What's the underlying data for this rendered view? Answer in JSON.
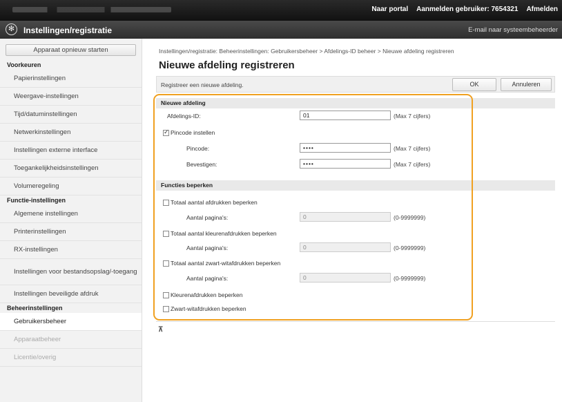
{
  "topbar": {
    "portal": "Naar portal",
    "logged_in_label": "Aanmelden gebruiker:",
    "user_id": "7654321",
    "logout": "Afmelden"
  },
  "titlebar": {
    "title": "Instellingen/registratie",
    "mail_admin": "E-mail naar systeembeheerder"
  },
  "sidebar": {
    "restart_button": "Apparaat opnieuw starten",
    "groups": [
      {
        "label": "Voorkeuren",
        "items": [
          "Papierinstellingen",
          "Weergave-instellingen",
          "Tijd/datuminstellingen",
          "Netwerkinstellingen",
          "Instellingen externe interface",
          "Toegankelijkheidsinstellingen",
          "Volumeregeling"
        ]
      },
      {
        "label": "Functie-instellingen",
        "items": [
          "Algemene instellingen",
          "Printerinstellingen",
          "RX-instellingen",
          "Instellingen voor bestandsopslag/-toegang",
          "Instellingen beveiligde afdruk"
        ]
      },
      {
        "label": "Beheerinstellingen",
        "items": [
          "Gebruikersbeheer",
          "Apparaatbeheer",
          "Licentie/overig"
        ]
      }
    ]
  },
  "breadcrumb": "Instellingen/registratie: Beheerinstellingen: Gebruikersbeheer > Afdelings-ID beheer > Nieuwe afdeling registreren",
  "page_title": "Nieuwe afdeling registreren",
  "actionbar": {
    "description": "Registreer een nieuwe afdeling.",
    "ok": "OK",
    "cancel": "Annuleren"
  },
  "new_department": {
    "heading": "Nieuwe afdeling",
    "dept_id_label": "Afdelings-ID:",
    "dept_id_value": "01",
    "dept_id_hint": "(Max 7 cijfers)",
    "set_pin_label": "Pincode instellen",
    "set_pin_checked": true,
    "pin_label": "Pincode:",
    "pin_value": "••••",
    "pin_hint": "(Max 7 cijfers)",
    "confirm_label": "Bevestigen:",
    "confirm_value": "••••",
    "confirm_hint": "(Max 7 cijfers)"
  },
  "restrict_functions": {
    "heading": "Functies beperken",
    "total_prints_label": "Totaal aantal afdrukken beperken",
    "total_prints_pages_label": "Aantal pagina's:",
    "total_prints_pages_value": "0",
    "total_prints_range": "(0-9999999)",
    "color_prints_label": "Totaal aantal kleurenafdrukken beperken",
    "color_prints_pages_label": "Aantal pagina's:",
    "color_prints_pages_value": "0",
    "color_prints_range": "(0-9999999)",
    "bw_prints_label": "Totaal aantal zwart-witafdrukken beperken",
    "bw_prints_pages_label": "Aantal pagina's:",
    "bw_prints_pages_value": "0",
    "bw_prints_range": "(0-9999999)",
    "restrict_color_label": "Kleurenafdrukken beperken",
    "restrict_bw_label": "Zwart-witafdrukken beperken"
  },
  "to_top": "⊼",
  "colors": {
    "highlight": "#f0a020",
    "topbar": "#1a1a1a",
    "titlebar": "#3a3a3a"
  }
}
